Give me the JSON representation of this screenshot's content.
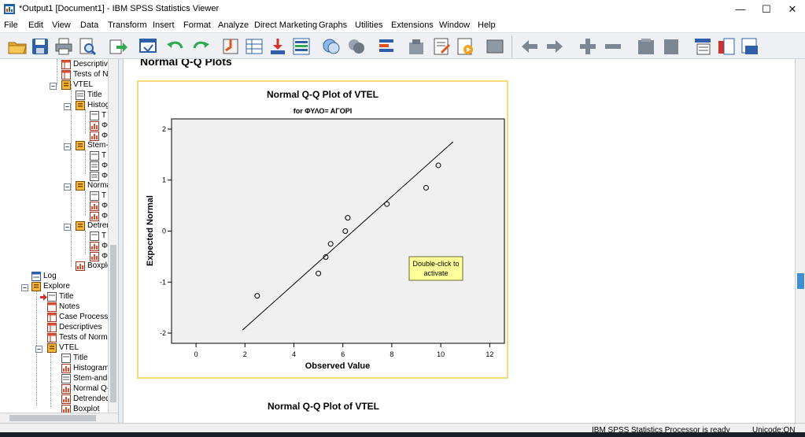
{
  "window": {
    "title": "*Output1 [Document1] - IBM SPSS Statistics Viewer",
    "minimize_glyph": "—",
    "maximize_glyph": "☐",
    "close_glyph": "✕"
  },
  "menu": [
    "File",
    "Edit",
    "View",
    "Data",
    "Transform",
    "Insert",
    "Format",
    "Analyze",
    "Direct Marketing",
    "Graphs",
    "Utilities",
    "Extensions",
    "Window",
    "Help"
  ],
  "toolbar_icons": [
    "open-icon",
    "save-icon",
    "print-icon",
    "print-preview-icon",
    "export-icon",
    "recall-dialog-icon",
    "undo-icon",
    "redo-icon",
    "goto-data-icon",
    "goto-case-icon",
    "goto-variable-icon",
    "variables-icon",
    "show-all-icon",
    "designate-window-icon",
    "insert-output-icon",
    "select-last-output-icon",
    "promote-icon",
    "demote-icon",
    "expand-icon",
    "collapse-icon",
    "show-icon",
    "hide-icon",
    "insert-heading-icon",
    "insert-title-icon",
    "insert-text-icon"
  ],
  "navigator": {
    "items": [
      {
        "label": "Descriptives",
        "level": 4
      },
      {
        "label": "Tests of Normality",
        "level": 4
      },
      {
        "label": "VTEL",
        "level": 3
      },
      {
        "label": "Title",
        "level": 4
      },
      {
        "label": "Histogram",
        "level": 4
      },
      {
        "label": "Stem-and-Leaf",
        "level": 4
      },
      {
        "label": "Normal Q-Q",
        "level": 4
      },
      {
        "label": "Detrended",
        "level": 4
      },
      {
        "label": "Boxplot",
        "level": 4
      },
      {
        "label": "Log",
        "level": 1
      },
      {
        "label": "Explore",
        "level": 1
      },
      {
        "label": "Title",
        "level": 2
      },
      {
        "label": "Notes",
        "level": 2
      },
      {
        "label": "Case Processing",
        "level": 2
      },
      {
        "label": "Descriptives",
        "level": 2
      },
      {
        "label": "Tests of Normality",
        "level": 2
      },
      {
        "label": "VTEL",
        "level": 2
      },
      {
        "label": "Title",
        "level": 3
      },
      {
        "label": "Histogram",
        "level": 3
      },
      {
        "label": "Stem-and-Leaf",
        "level": 3
      },
      {
        "label": "Normal Q-Q",
        "level": 3
      },
      {
        "label": "Detrended",
        "level": 3
      },
      {
        "label": "Boxplot",
        "level": 3
      }
    ],
    "sub_labels": [
      "T",
      "Φ",
      "Φ"
    ]
  },
  "content": {
    "section_title": "Normal Q-Q Plots",
    "tooltip": "Double-click to activate",
    "next_plot_title": "Normal Q-Q Plot of VTEL"
  },
  "chart_data": {
    "type": "scatter",
    "title": "Normal Q-Q Plot of VTEL",
    "subtitle": "for ΦΥΛΟ= ΑΓΟΡΙ",
    "xlabel": "Observed Value",
    "ylabel": "Expected Normal",
    "xlim": [
      -1,
      12.6
    ],
    "ylim": [
      -2.2,
      2.2
    ],
    "xticks": [
      0,
      2,
      4,
      6,
      8,
      10,
      12
    ],
    "yticks": [
      -2,
      -1,
      0,
      1,
      2
    ],
    "grid": false,
    "points": [
      {
        "x": 2.5,
        "y": -1.27
      },
      {
        "x": 5.0,
        "y": -0.83
      },
      {
        "x": 5.3,
        "y": -0.51
      },
      {
        "x": 5.5,
        "y": -0.25
      },
      {
        "x": 6.1,
        "y": 0.0
      },
      {
        "x": 6.2,
        "y": 0.26
      },
      {
        "x": 7.8,
        "y": 0.53
      },
      {
        "x": 9.4,
        "y": 0.85
      },
      {
        "x": 9.9,
        "y": 1.29
      }
    ],
    "reference_line": {
      "x": [
        1.9,
        10.5
      ],
      "y": [
        -1.94,
        1.75
      ]
    },
    "background": "#f0f0f0",
    "marker_color": "#000000"
  },
  "status": {
    "processor": "IBM SPSS Statistics Processor is ready",
    "unicode": "Unicode:ON"
  },
  "colors": {
    "chart_border": "#f6d97a",
    "tooltip_bg": "#ffff99",
    "scroll_thumb": "#3f8fd2"
  }
}
